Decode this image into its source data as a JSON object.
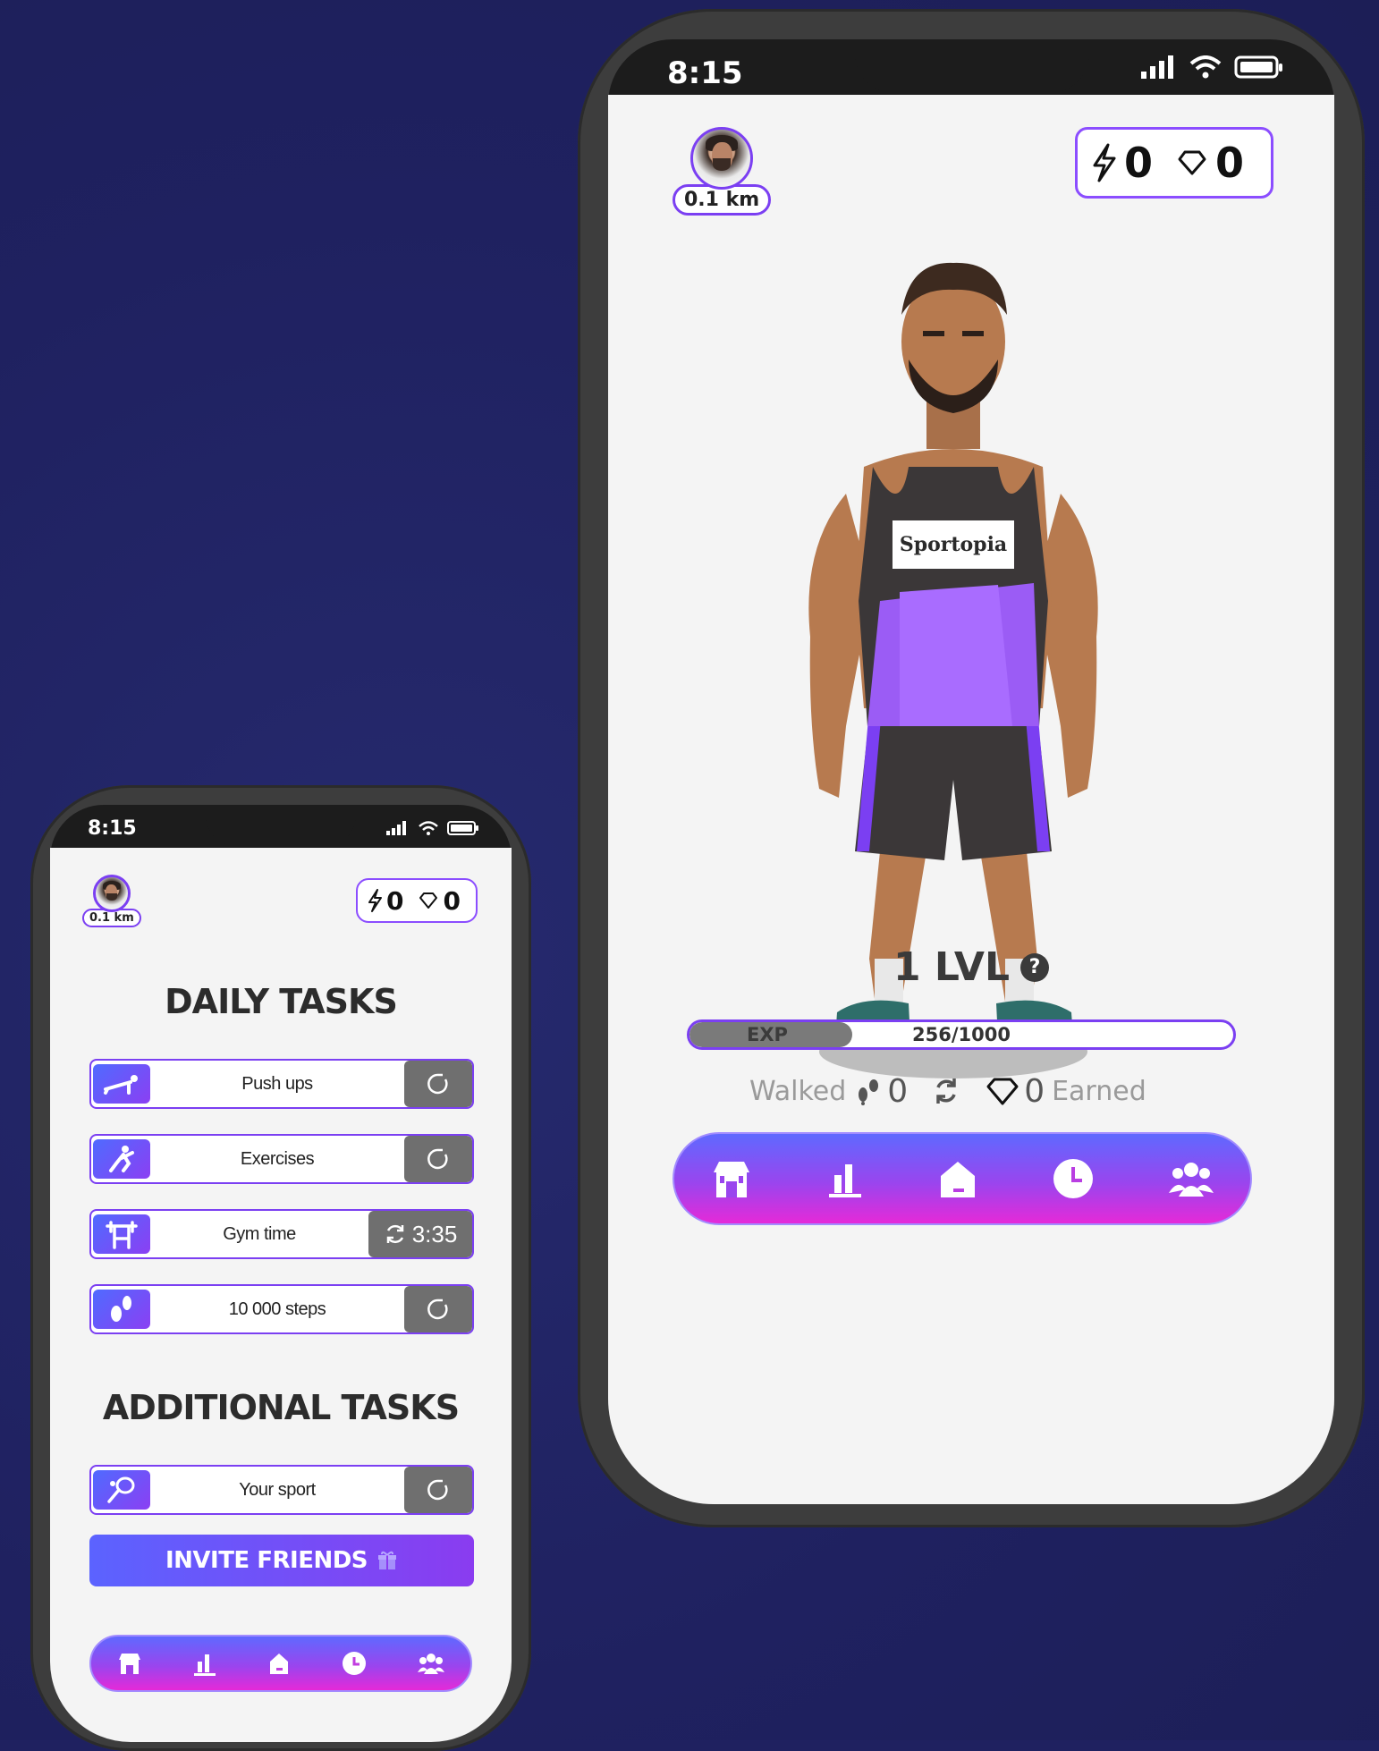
{
  "colors": {
    "background": "#1f2160",
    "accent": "#7b3ff2",
    "nav_gradient_top": "#5f69ff",
    "nav_gradient_bottom": "#e52ad8"
  },
  "small_phone": {
    "status": {
      "time": "8:15"
    },
    "profile": {
      "distance": "0.1 km"
    },
    "currency": {
      "energy": "0",
      "gems": "0"
    },
    "daily_heading": "DAILY TASKS",
    "daily_tasks": [
      {
        "label": "Push ups",
        "icon": "pushup-icon",
        "action": "refresh-icon"
      },
      {
        "label": "Exercises",
        "icon": "exercise-icon",
        "action": "refresh-icon"
      },
      {
        "label": "Gym time",
        "icon": "gym-icon",
        "action": "3:35"
      },
      {
        "label": "10 000 steps",
        "icon": "footsteps-icon",
        "action": "refresh-icon"
      }
    ],
    "additional_heading": "ADDITIONAL TASKS",
    "additional_tasks": [
      {
        "label": "Your sport",
        "icon": "racket-icon",
        "action": "refresh-icon"
      }
    ],
    "invite_label": "INVITE FRIENDS",
    "nav": [
      "shop-icon",
      "leaderboard-icon",
      "home-icon",
      "history-icon",
      "friends-icon"
    ]
  },
  "big_phone": {
    "status": {
      "time": "8:15"
    },
    "profile": {
      "distance": "0.1 km"
    },
    "currency": {
      "energy": "0",
      "gems": "0"
    },
    "character": {
      "shirt_text": "Sportopia"
    },
    "level": {
      "label": "1 LVL"
    },
    "exp": {
      "label": "EXP",
      "value": "256/1000",
      "current": 256,
      "max": 1000
    },
    "stats": {
      "walked_label": "Walked",
      "walked_value": "0",
      "earned_value": "0",
      "earned_label": "Earned"
    },
    "nav": [
      "shop-icon",
      "leaderboard-icon",
      "home-icon",
      "history-icon",
      "friends-icon"
    ]
  }
}
